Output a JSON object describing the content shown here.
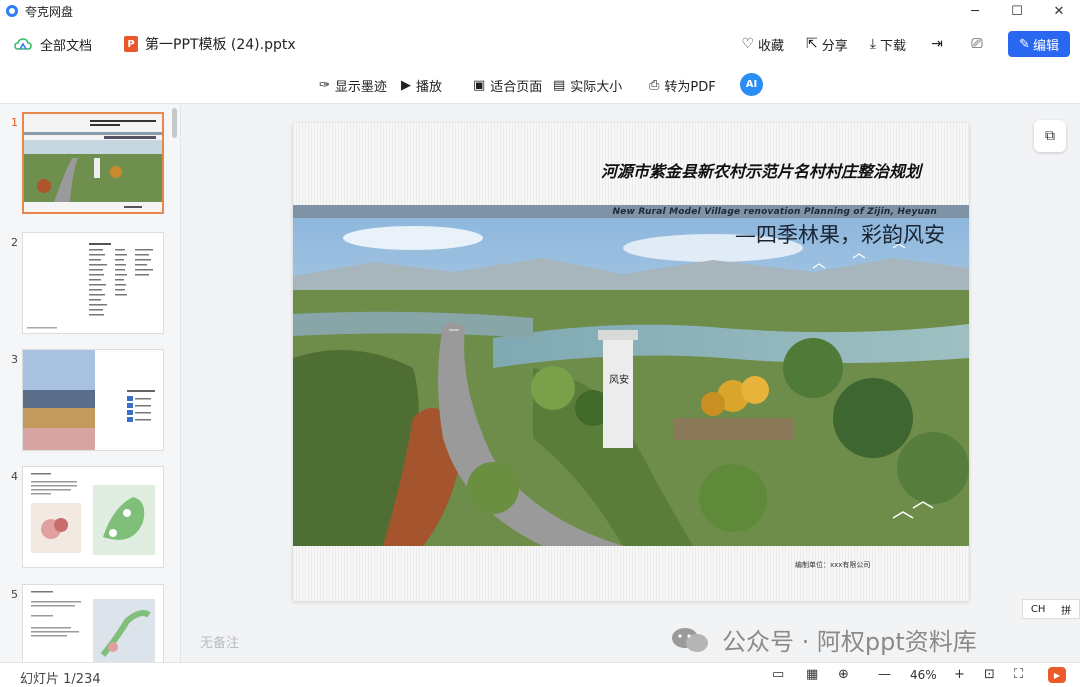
{
  "app": {
    "name": "夸克网盘",
    "minimize": "─",
    "maximize": "☐",
    "close": "✕"
  },
  "docbar": {
    "all_docs": "全部文档",
    "file_icon": "P",
    "file_name": "第一PPT模板 (24).pptx",
    "collect": "收藏",
    "share": "分享",
    "download": "下载",
    "edit": "编辑"
  },
  "toolbar": {
    "ink": "显示墨迹",
    "play": "播放",
    "fit_page": "适合页面",
    "actual_size": "实际大小",
    "to_pdf": "转为PDF",
    "ai": "AI"
  },
  "thumbnails": [
    {
      "num": "1",
      "active": true
    },
    {
      "num": "2",
      "active": false
    },
    {
      "num": "3",
      "active": false
    },
    {
      "num": "4",
      "active": false
    },
    {
      "num": "5",
      "active": false
    }
  ],
  "slide": {
    "title": "河源市紫金县新农村示范片名村村庄整治规划",
    "subtitle_en": "New Rural Model Village renovation Planning of Zijin, Heyuan",
    "subtitle_cn": "—四季林果，彩韵风安",
    "credit": "编制单位：xxx有限公司",
    "sign": "风安"
  },
  "notes_placeholder": "无备注",
  "ime": {
    "lang": "CH",
    "mode": "拼"
  },
  "watermark": "公众号 · 阿权ppt资料库",
  "statusbar": {
    "slide_count": "幻灯片 1/234",
    "zoom": "46%",
    "zoom_out": "—",
    "zoom_in": "+"
  },
  "colors": {
    "accent": "#2a67f0",
    "ppt_orange": "#e8582b",
    "ai_blue": "#2a8cf5"
  }
}
